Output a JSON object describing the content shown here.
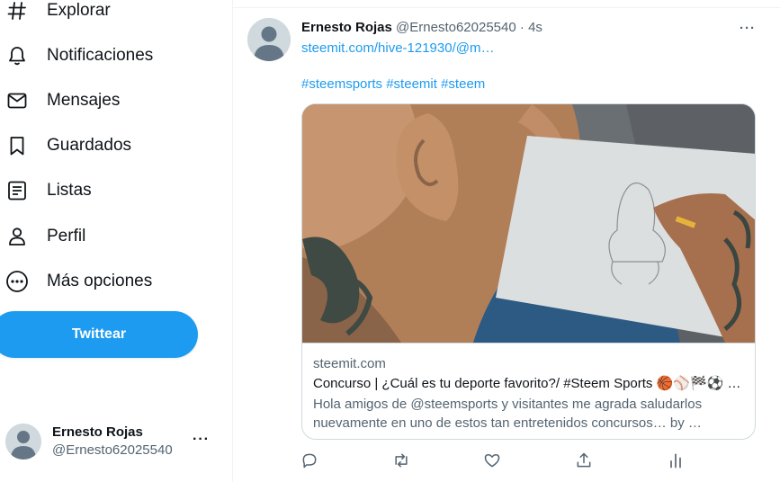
{
  "sidebar": {
    "items": [
      {
        "label": "Explorar",
        "icon": "hashtag-icon"
      },
      {
        "label": "Notificaciones",
        "icon": "bell-icon"
      },
      {
        "label": "Mensajes",
        "icon": "envelope-icon"
      },
      {
        "label": "Guardados",
        "icon": "bookmark-icon"
      },
      {
        "label": "Listas",
        "icon": "list-icon"
      },
      {
        "label": "Perfil",
        "icon": "person-icon"
      },
      {
        "label": "Más opciones",
        "icon": "more-circle-icon"
      }
    ],
    "tweet_button": "Twittear",
    "account": {
      "name": "Ernesto Rojas",
      "handle": "@Ernesto62025540",
      "more": "···"
    }
  },
  "tweet": {
    "author_name": "Ernesto Rojas",
    "author_handle": "@Ernesto62025540",
    "separator": "·",
    "time": "4s",
    "more": "···",
    "link": "steemit.com/hive-121930/@m…",
    "hashtags": [
      "#steemsports",
      "#steemit",
      "#steem"
    ],
    "card": {
      "domain": "steemit.com",
      "title": "Concurso | ¿Cuál es tu deporte favorito?/ #Steem Sports 🏀⚾🏁⚽ …",
      "description": "Hola amigos de @steemsports y visitantes me agrada saludarlos nuevamente en uno de estos tan entretenidos concursos… by …"
    },
    "actions": [
      "reply-icon",
      "retweet-icon",
      "like-icon",
      "share-icon",
      "analytics-icon"
    ]
  },
  "colors": {
    "accent": "#1d9bf0",
    "text": "#0f1419",
    "secondary": "#536471",
    "border": "#cfd9de"
  }
}
